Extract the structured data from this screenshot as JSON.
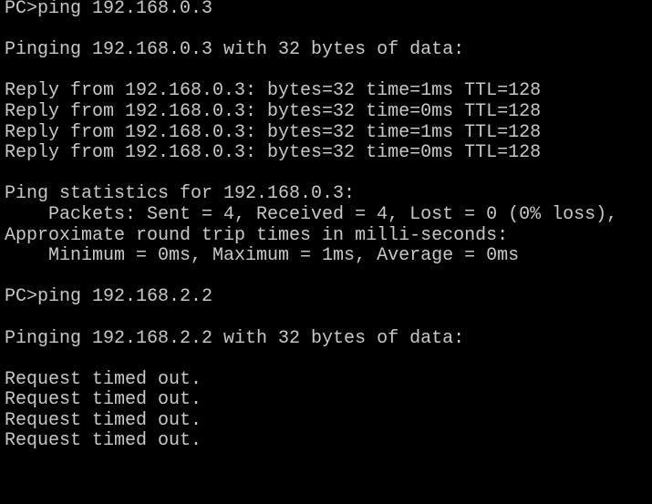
{
  "terminal": {
    "lines": [
      "PC>ping 192.168.0.3",
      "",
      "Pinging 192.168.0.3 with 32 bytes of data:",
      "",
      "Reply from 192.168.0.3: bytes=32 time=1ms TTL=128",
      "Reply from 192.168.0.3: bytes=32 time=0ms TTL=128",
      "Reply from 192.168.0.3: bytes=32 time=1ms TTL=128",
      "Reply from 192.168.0.3: bytes=32 time=0ms TTL=128",
      "",
      "Ping statistics for 192.168.0.3:",
      "    Packets: Sent = 4, Received = 4, Lost = 0 (0% loss),",
      "Approximate round trip times in milli-seconds:",
      "    Minimum = 0ms, Maximum = 1ms, Average = 0ms",
      "",
      "PC>ping 192.168.2.2",
      "",
      "Pinging 192.168.2.2 with 32 bytes of data:",
      "",
      "Request timed out.",
      "Request timed out.",
      "Request timed out.",
      "Request timed out."
    ],
    "colors": {
      "background": "#000000",
      "text": "#c8c8c8"
    }
  }
}
